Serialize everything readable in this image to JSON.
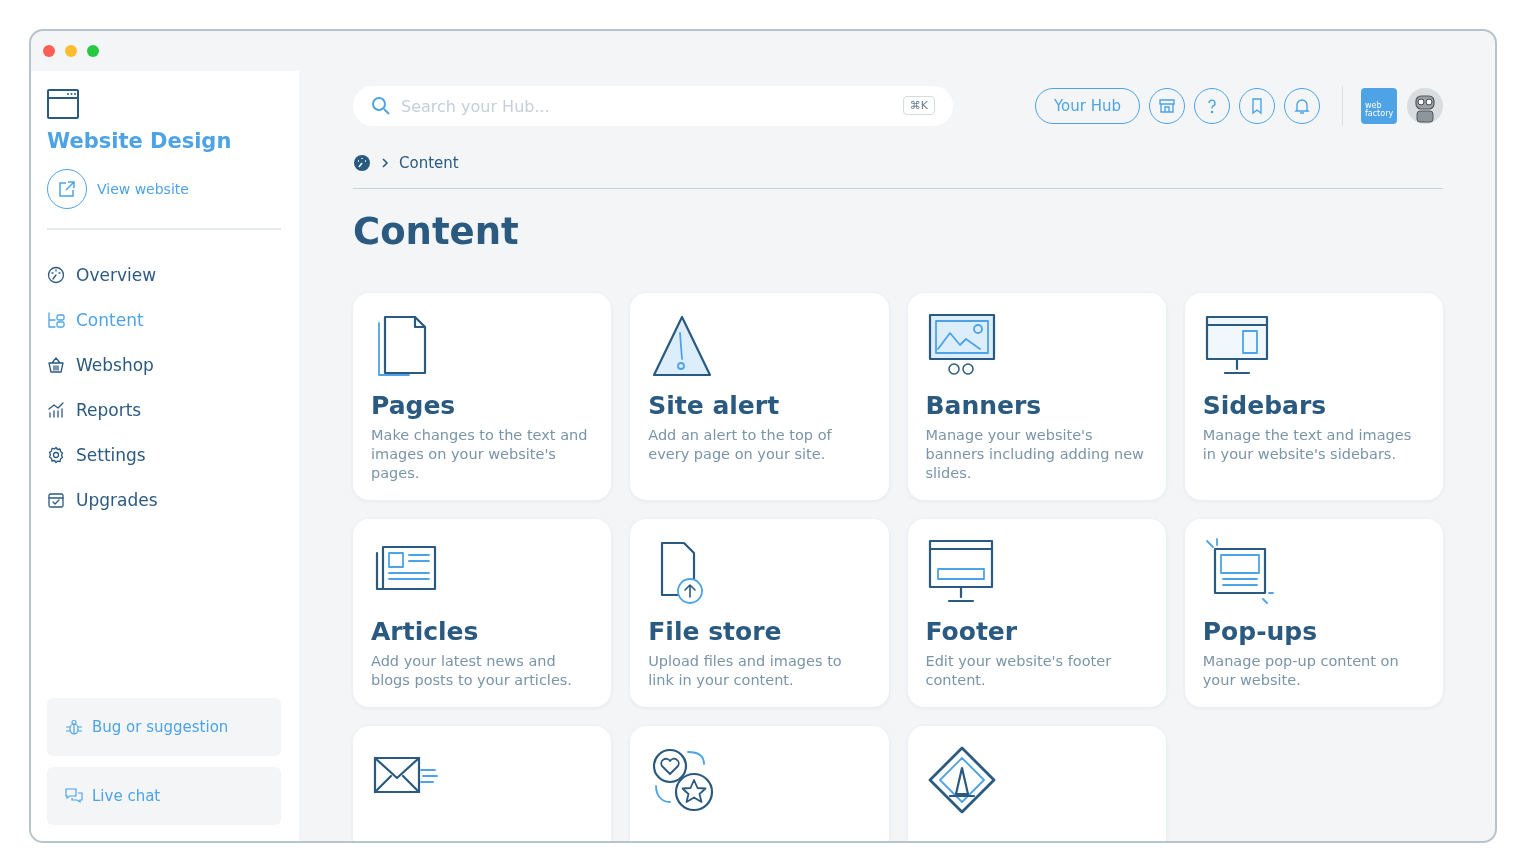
{
  "window": {
    "controls": [
      {
        "color": "#ff5f57"
      },
      {
        "color": "#febc2e"
      },
      {
        "color": "#28c840"
      }
    ]
  },
  "sidebar": {
    "site_title": "Website Design",
    "view_website": "View website",
    "items": [
      {
        "label": "Overview",
        "selected": false
      },
      {
        "label": "Content",
        "selected": true
      },
      {
        "label": "Webshop",
        "selected": false
      },
      {
        "label": "Reports",
        "selected": false
      },
      {
        "label": "Settings",
        "selected": false
      },
      {
        "label": "Upgrades",
        "selected": false
      }
    ],
    "help": [
      "Bug or suggestion",
      "Live chat"
    ]
  },
  "topbar": {
    "search": {
      "placeholder": "Search your Hub...",
      "shortcut": "⌘K"
    },
    "hub_button": "Your Hub",
    "brand_badge": "web factory"
  },
  "breadcrumb": [
    "Content"
  ],
  "page_title": "Content",
  "cards": [
    {
      "kind": "full",
      "title": "Pages",
      "description": "Make changes to the text and images on your website's pages."
    },
    {
      "kind": "full",
      "title": "Site alert",
      "description": "Add an alert to the top of every page on your site."
    },
    {
      "kind": "full",
      "title": "Banners",
      "description": "Manage your website's banners including adding new slides."
    },
    {
      "kind": "full",
      "title": "Sidebars",
      "description": "Manage the text and images in your website's sidebars."
    },
    {
      "kind": "full",
      "title": "Articles",
      "description": "Add your latest news and blogs posts to your articles."
    },
    {
      "kind": "full",
      "title": "File store",
      "description": "Upload files and images to link in your content."
    },
    {
      "kind": "full",
      "title": "Footer",
      "description": "Edit your website's footer content."
    },
    {
      "kind": "full",
      "title": "Pop-ups",
      "description": "Manage pop-up content on your website."
    },
    {
      "kind": "cut_off"
    },
    {
      "kind": "cut_off"
    },
    {
      "kind": "cut_off"
    }
  ]
}
